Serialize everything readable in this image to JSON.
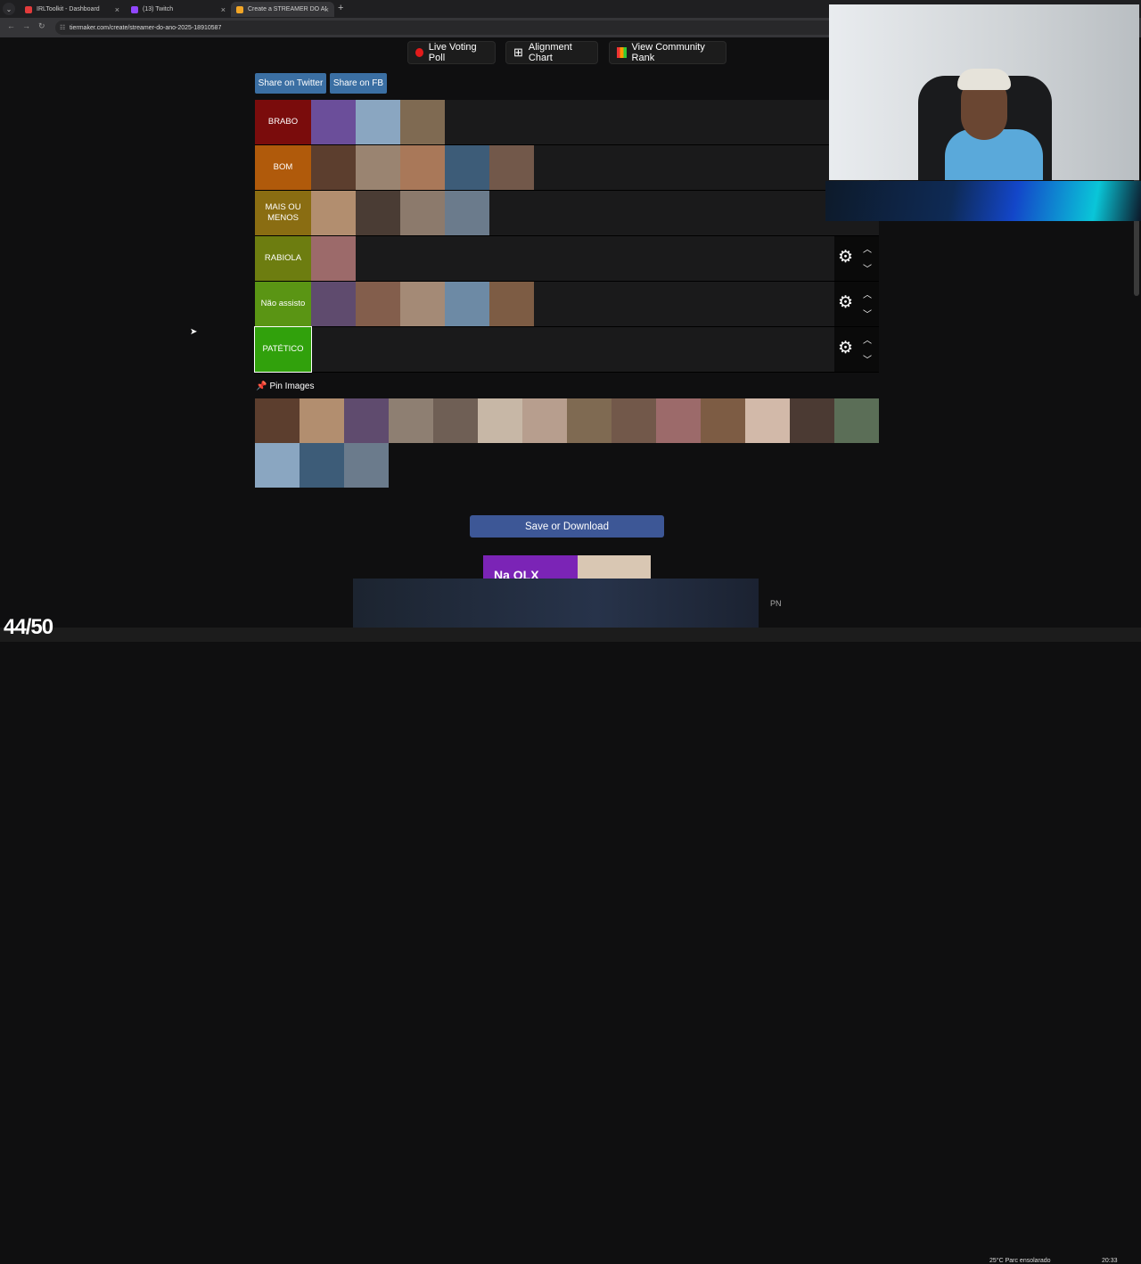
{
  "browser": {
    "tabs": [
      {
        "title": "IRLToolkit - Dashboard",
        "color": "#e23b3b",
        "active": false
      },
      {
        "title": "(13) Twitch",
        "color": "#9147ff",
        "active": false
      },
      {
        "title": "Create a STREAMER DO ANO D",
        "color": "#f2a626",
        "active": true
      }
    ],
    "url": "tiermaker.com/create/streamer-do-ano-2025-18910587"
  },
  "toolbar": {
    "live_voting": "Live Voting Poll",
    "alignment_chart": "Alignment Chart",
    "community_rank": "View Community Rank"
  },
  "share": {
    "twitter": "Share on Twitter",
    "fb": "Share on FB"
  },
  "tiers": [
    {
      "label": "BRABO",
      "color": "#7a0c0c",
      "count": 3
    },
    {
      "label": "BOM",
      "color": "#b05a0b",
      "count": 5
    },
    {
      "label": "MAIS OU MENOS",
      "color": "#8a6d12",
      "count": 4
    },
    {
      "label": "RABIOLA",
      "color": "#6d7d10",
      "count": 1
    },
    {
      "label": "Não assisto",
      "color": "#5a9514",
      "count": 5
    },
    {
      "label": "PATÉTICO",
      "color": "#31a10c",
      "count": 0
    }
  ],
  "pin_label": "Pin Images",
  "pool_count": 17,
  "save_label": "Save or Download",
  "ad_text": "Na OLX",
  "ad_aside": "PN",
  "counter": "44/50",
  "weather": "25°C Parc ensolarado",
  "clock": "20:33",
  "thumb_colors": [
    "#6b4e9a",
    "#8aa6c1",
    "#7f6a52",
    "#5c3e2e",
    "#9a8471",
    "#a97859",
    "#3d5c78",
    "#72584a",
    "#b28e6f",
    "#4a3c34",
    "#8c7a6c",
    "#6b7b8c",
    "#9c6a6a",
    "#5f4b6e",
    "#835e4c",
    "#a48a76",
    "#6d8aa5",
    "#7d5c44",
    "#8e7f72",
    "#c29ba1",
    "#5a4a40",
    "#b8a594",
    "#d2b9a9",
    "#6f5f55",
    "#a6c0d4",
    "#9e8b7a",
    "#e8ddd0",
    "#4b3a33",
    "#c7b7a6",
    "#3a3030",
    "#7b8795",
    "#c9c3bb",
    "#5b6e57",
    "#b79e8e",
    "#d99fb5",
    "#2f2f33"
  ]
}
